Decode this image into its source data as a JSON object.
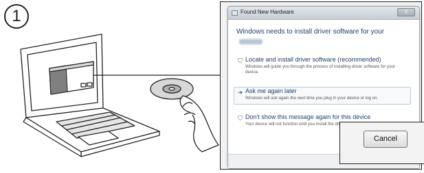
{
  "step": {
    "number": "1"
  },
  "dialog": {
    "title": "Found New Hardware",
    "close_label": "X",
    "heading": "Windows needs to install driver software for your",
    "options": [
      {
        "icon": "shield-icon",
        "title": "Locate and install driver software (recommended)",
        "description": "Windows will guide you through the process of installing driver software for your device."
      },
      {
        "icon": "arrow-right-icon",
        "title": "Ask me again later",
        "description": "Windows will ask again the next time you plug in your device or log on."
      },
      {
        "icon": "shield-icon",
        "title": "Don't show this message again for this device",
        "description": "Your device will not function until you install the driver software."
      }
    ]
  },
  "cancel_zoom": {
    "cancel_label": "Cancel"
  }
}
